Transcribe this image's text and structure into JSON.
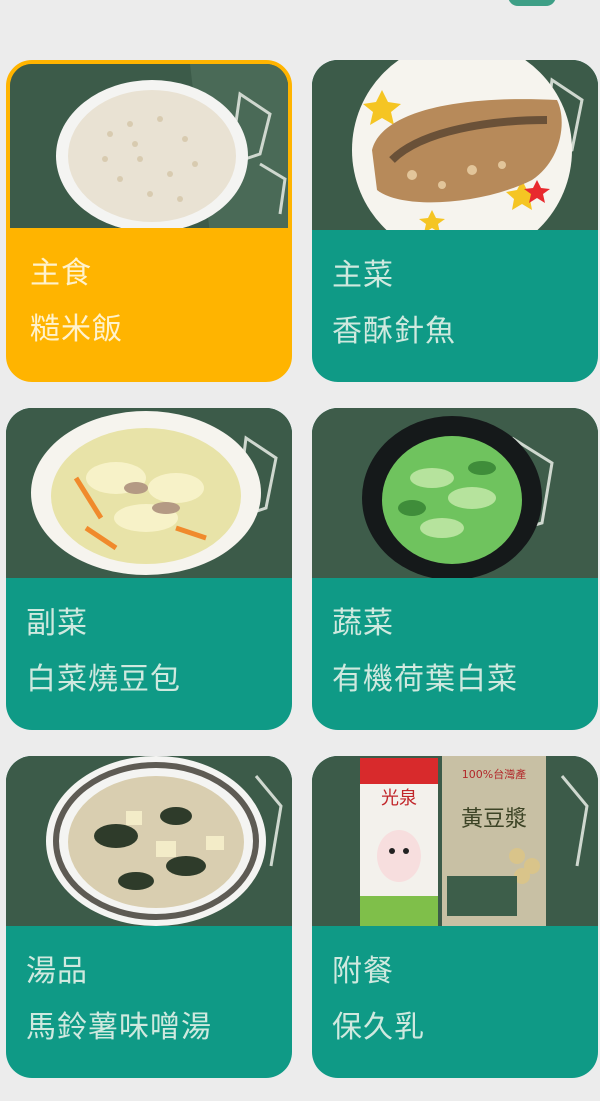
{
  "meals": [
    {
      "category": "主食",
      "name": "糙米飯",
      "selected": true
    },
    {
      "category": "主菜",
      "name": "香酥針魚",
      "selected": false
    },
    {
      "category": "副菜",
      "name": "白菜燒豆包",
      "selected": false
    },
    {
      "category": "蔬菜",
      "name": "有機荷葉白菜",
      "selected": false
    },
    {
      "category": "湯品",
      "name": "馬鈴薯味噌湯",
      "selected": false
    },
    {
      "category": "附餐",
      "name": "保久乳",
      "selected": false
    }
  ],
  "colors": {
    "selected": "#ffb400",
    "card": "#0f9a86",
    "background": "#ececec"
  },
  "photo_text": {
    "milk_brand": "光泉",
    "soy_label": "100%台灣產",
    "soy_name": "黃豆漿"
  }
}
